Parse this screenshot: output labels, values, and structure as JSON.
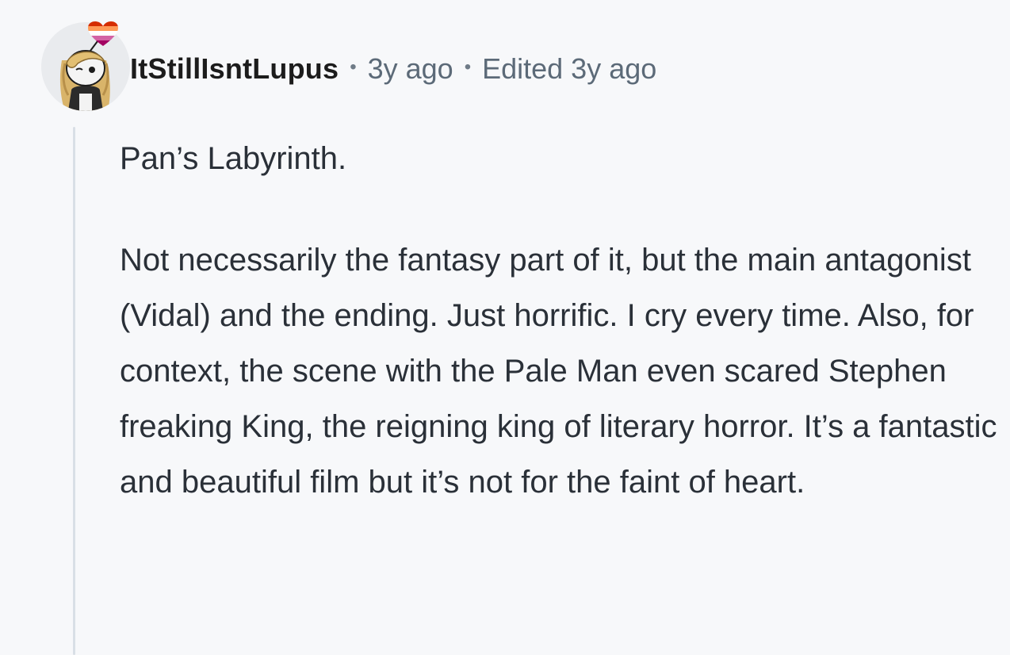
{
  "comment": {
    "username": "ItStillIsntLupus",
    "separator": "•",
    "timestamp": "3y ago",
    "edited": "Edited 3y ago",
    "paragraphs": [
      "Pan’s Labyrinth.",
      "Not necessarily the fantasy part of it, but the main antagonist (Vidal) and the ending. Just horrific. I cry every time. Also, for context, the scene with the Pale Man even scared Stephen freaking King, the reigning king of literary horror. It’s a fantastic and beautiful film but it’s not for the faint of heart."
    ]
  },
  "colors": {
    "background": "#f7f8fa",
    "thread_line": "#d9dfe6",
    "meta_text": "#5c6a78",
    "body_text": "#2a3038"
  },
  "icons": {
    "avatar": "user-avatar-illustration",
    "flair": "lesbian-pride-heart-icon"
  }
}
